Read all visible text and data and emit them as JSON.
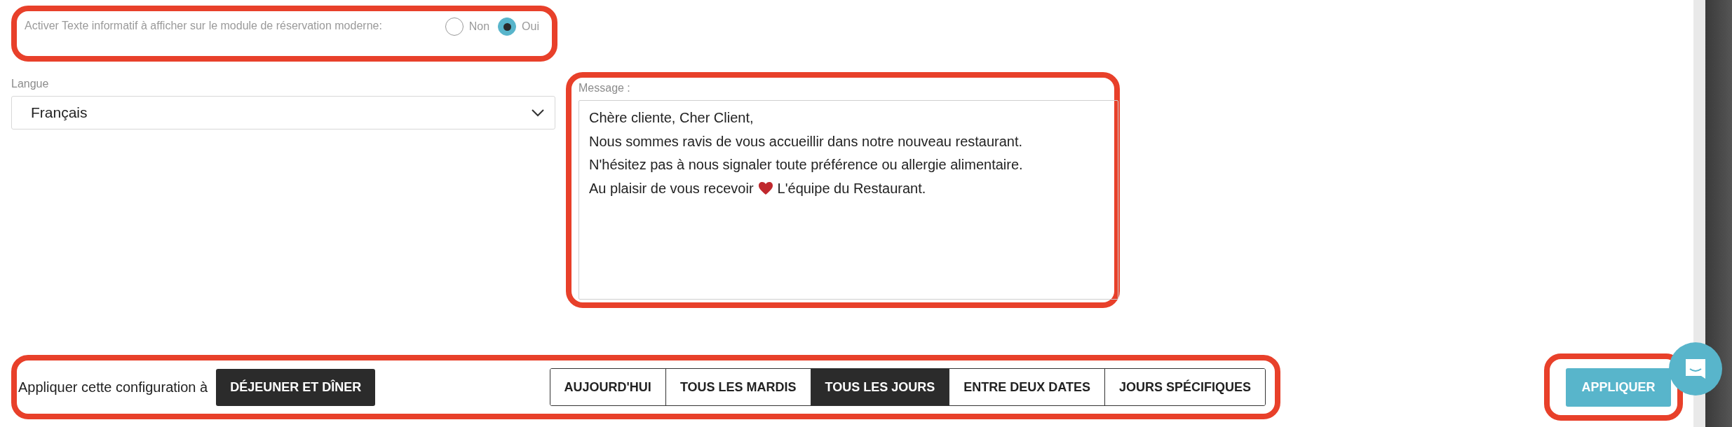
{
  "info_toggle": {
    "highlighted": true,
    "label": "Activer Texte informatif à afficher sur le module de réservation moderne:",
    "options": [
      {
        "label": "Non",
        "selected": false
      },
      {
        "label": "Oui",
        "selected": true
      }
    ]
  },
  "language": {
    "label": "Langue",
    "value": "Français"
  },
  "message": {
    "highlighted": true,
    "label": "Message :",
    "lines": [
      [
        {
          "kind": "text",
          "text": "Chère cliente, Cher Client,"
        }
      ],
      [
        {
          "kind": "text",
          "text": "Nous sommes ravis de vous accueillir dans notre nouveau restaurant."
        }
      ],
      [
        {
          "kind": "text",
          "text": "N'hésitez pas à nous signaler toute préférence ou allergie alimentaire."
        }
      ],
      [
        {
          "kind": "text",
          "text": "Au plaisir de vous recevoir"
        },
        {
          "kind": "heart"
        },
        {
          "kind": "text",
          "text": "L'équipe du Restaurant."
        }
      ]
    ]
  },
  "apply_bar": {
    "highlighted": true,
    "label": "Appliquer cette configuration à",
    "service": "DÉJEUNER ET DÎNER",
    "periods": [
      {
        "label": "AUJOURD'HUI",
        "selected": false
      },
      {
        "label": "TOUS LES MARDIS",
        "selected": false
      },
      {
        "label": "TOUS LES JOURS",
        "selected": true
      },
      {
        "label": "ENTRE DEUX DATES",
        "selected": false
      },
      {
        "label": "JOURS SPÉCIFIQUES",
        "selected": false
      }
    ]
  },
  "apply_button": {
    "highlighted": true,
    "label": "APPLIQUER"
  }
}
